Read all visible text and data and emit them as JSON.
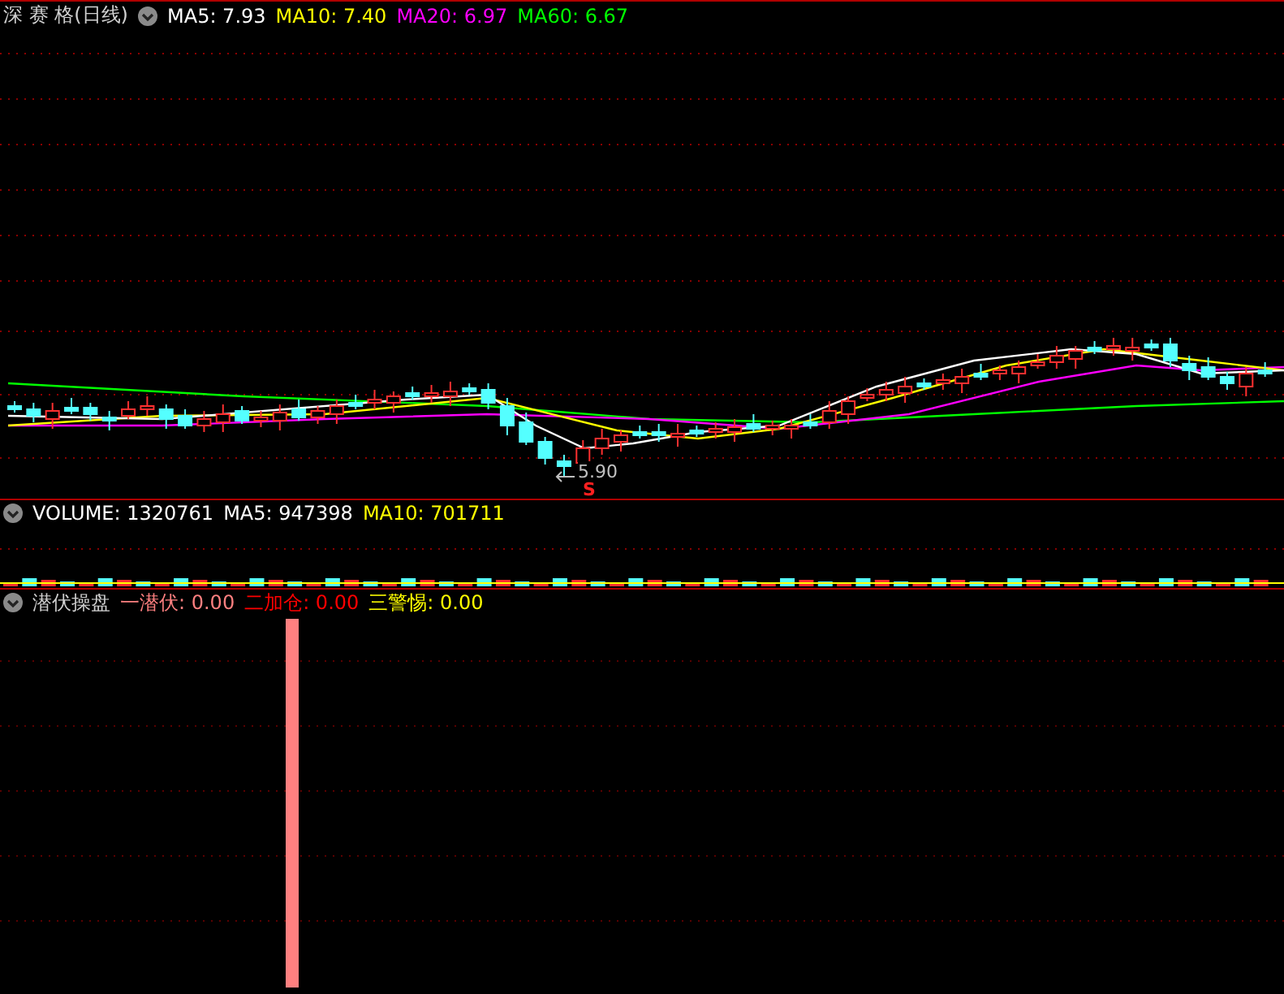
{
  "main_panel": {
    "title": "深 赛 格(日线)",
    "indicators": [
      {
        "label": "MA5:",
        "value": "7.93",
        "color": "#ffffff"
      },
      {
        "label": "MA10:",
        "value": "7.40",
        "color": "#ffff00"
      },
      {
        "label": "MA20:",
        "value": "6.97",
        "color": "#ff00ff"
      },
      {
        "label": "MA60:",
        "value": "6.67",
        "color": "#00ff00"
      }
    ],
    "low_price_label": "5.90",
    "signal_label": "S"
  },
  "volume_panel": {
    "indicators": [
      {
        "label": "VOLUME:",
        "value": "1320761",
        "color": "#ffffff"
      },
      {
        "label": "MA5:",
        "value": "947398",
        "color": "#ffffff"
      },
      {
        "label": "MA10:",
        "value": "701711",
        "color": "#ffff00"
      }
    ]
  },
  "indicator_panel": {
    "title": "潜伏操盘",
    "indicators": [
      {
        "label": "一潜伏:",
        "value": "0.00",
        "color": "#ff8080"
      },
      {
        "label": "二加仓:",
        "value": "0.00",
        "color": "#ff0000"
      },
      {
        "label": "三警惕:",
        "value": "0.00",
        "color": "#ffff00"
      }
    ]
  }
}
